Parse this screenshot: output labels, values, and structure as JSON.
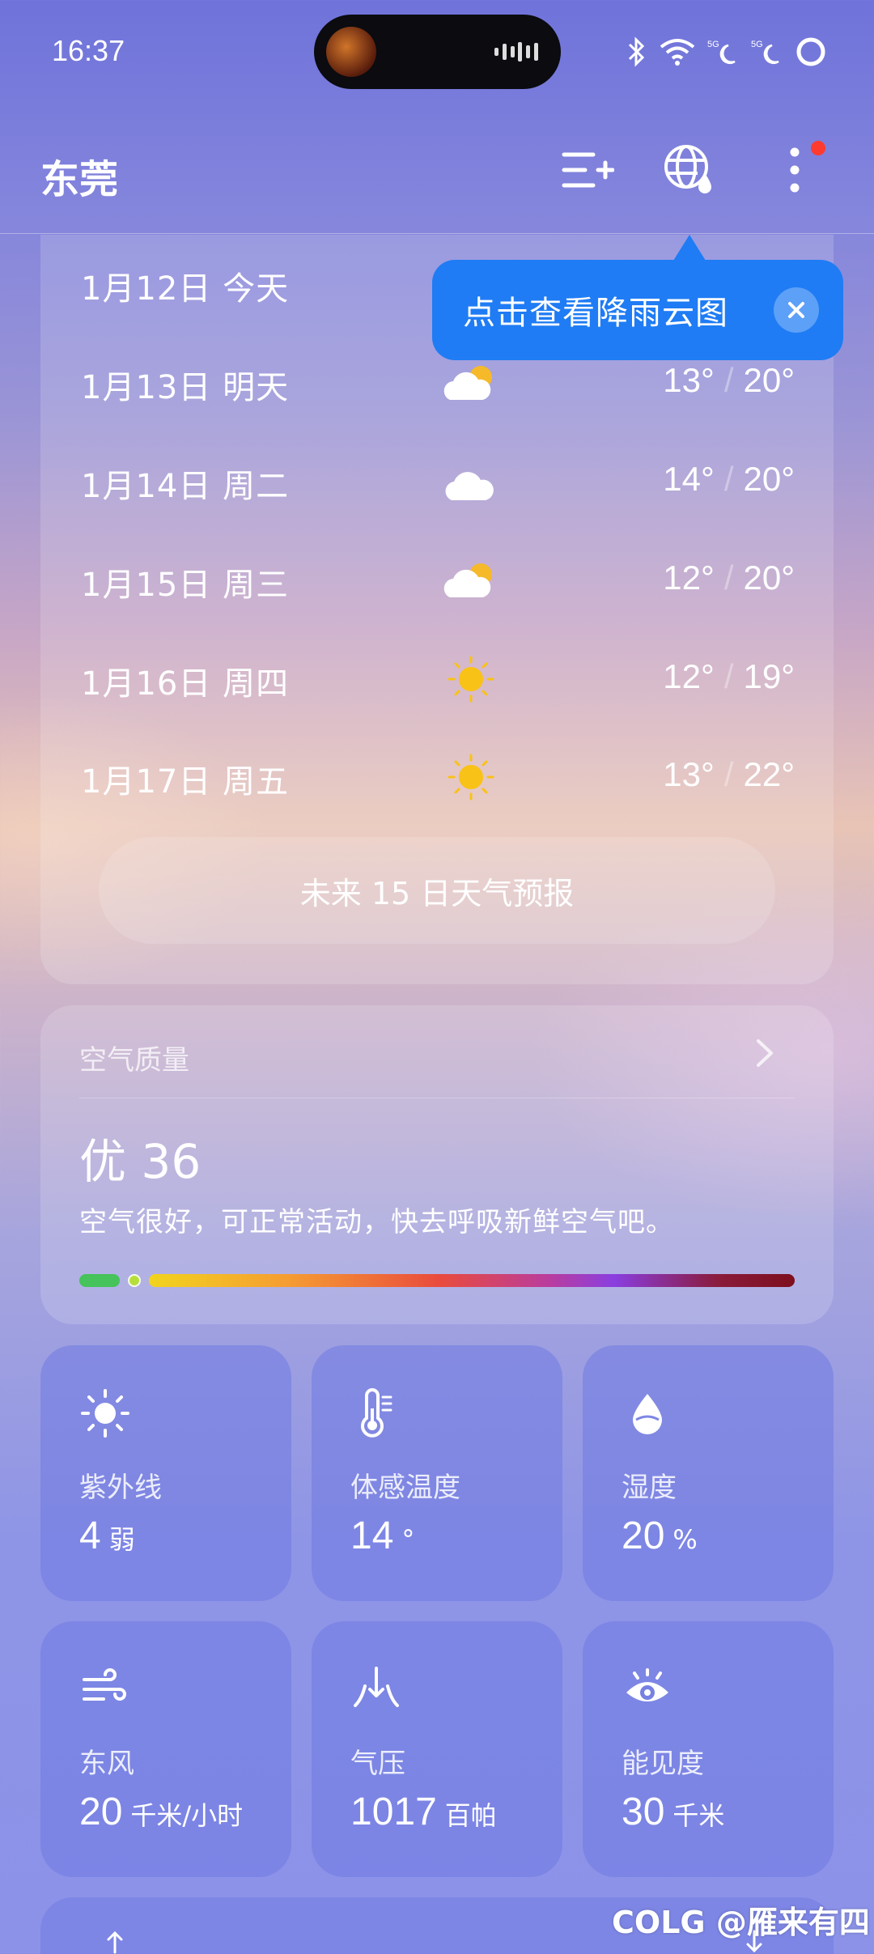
{
  "status_bar": {
    "time": "16:37"
  },
  "header": {
    "city": "东莞",
    "add_city_icon": "add-list-icon",
    "rain_map_icon": "globe-rain-icon",
    "more_icon": "more-vertical-icon"
  },
  "tooltip": {
    "text": "点击查看降雨云图"
  },
  "forecast": {
    "days": [
      {
        "date": "1月12日",
        "day": "今天",
        "icon": "cloudy-sun",
        "low": "",
        "high": ""
      },
      {
        "date": "1月13日",
        "day": "明天",
        "icon": "cloudy-sun",
        "low": "13°",
        "high": "20°"
      },
      {
        "date": "1月14日",
        "day": "周二",
        "icon": "cloud",
        "low": "14°",
        "high": "20°"
      },
      {
        "date": "1月15日",
        "day": "周三",
        "icon": "cloudy-sun",
        "low": "12°",
        "high": "20°"
      },
      {
        "date": "1月16日",
        "day": "周四",
        "icon": "sun",
        "low": "12°",
        "high": "19°"
      },
      {
        "date": "1月17日",
        "day": "周五",
        "icon": "sun",
        "low": "13°",
        "high": "22°"
      }
    ],
    "more_button": "未来 15 日天气预报"
  },
  "air_quality": {
    "label": "空气质量",
    "value": "优 36",
    "description": "空气很好，可正常活动，快去呼吸新鲜空气吧。",
    "colors": [
      "#46c35a",
      "#f2d41d",
      "#e94b3c",
      "#8a3ee0",
      "#7d0f1e"
    ]
  },
  "tiles": [
    {
      "label": "紫外线",
      "value": "4",
      "unit": "弱",
      "icon": "sun-icon"
    },
    {
      "label": "体感温度",
      "value": "14",
      "unit": "°",
      "icon": "thermometer-icon"
    },
    {
      "label": "湿度",
      "value": "20",
      "unit": "%",
      "icon": "humidity-drop-icon"
    },
    {
      "label": "东风",
      "value": "20",
      "unit": "千米/小时",
      "icon": "wind-icon"
    },
    {
      "label": "气压",
      "value": "1017",
      "unit": "百帕",
      "icon": "pressure-icon"
    },
    {
      "label": "能见度",
      "value": "30",
      "unit": "千米",
      "icon": "eye-icon"
    }
  ],
  "watermark": "COLG @雁来有四"
}
